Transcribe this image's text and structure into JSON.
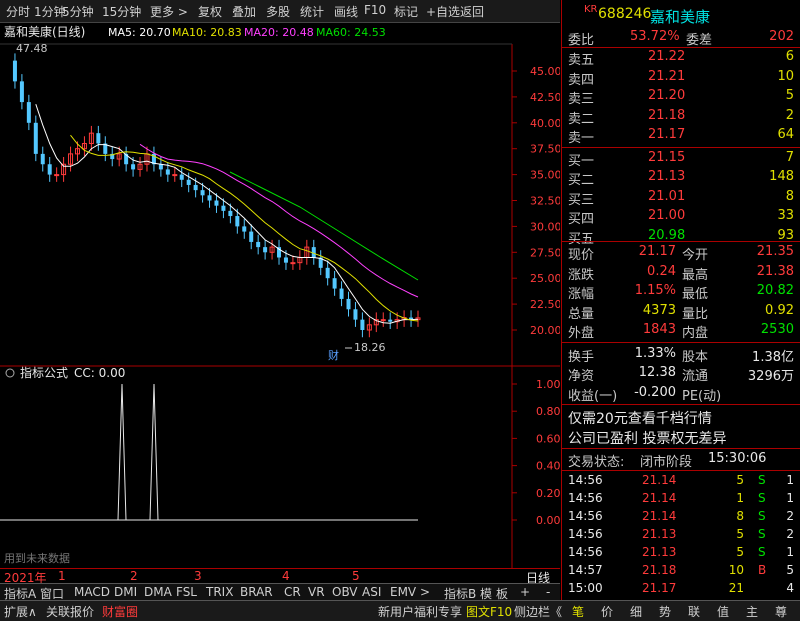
{
  "toolbar": {
    "items": [
      "分时",
      "1分钟",
      "5分钟",
      "15分钟",
      "更多 >",
      "复权",
      "叠加",
      "多股",
      "统计",
      "画线",
      "F10",
      "标记",
      "+自选",
      "返回"
    ]
  },
  "header": {
    "title": "嘉和美康(日线)",
    "ma5": "MA5: 20.70",
    "ma10": "MA10: 20.83",
    "ma20": "MA20: 20.48",
    "ma60": "MA60: 24.53"
  },
  "price_axis": [
    "45.00",
    "42.50",
    "40.00",
    "37.50",
    "35.00",
    "32.50",
    "30.00",
    "27.50",
    "25.00",
    "22.50",
    "20.00"
  ],
  "annotations": {
    "high": "47.48",
    "low": "18.26",
    "finance_marker": "财"
  },
  "indicator": {
    "title": "指标公式",
    "cc": "CC: 0.00",
    "axis": [
      "1.00",
      "0.80",
      "0.60",
      "0.40",
      "0.20",
      "0.00"
    ],
    "footer_note": "用到未来数据"
  },
  "date_axis": {
    "year": "2021年",
    "months": [
      "1",
      "2",
      "3",
      "4",
      "5"
    ],
    "period": "日线"
  },
  "indicator_tabs": [
    "指标A",
    "窗口",
    "MACD",
    "DMI",
    "DMA",
    "FSL",
    "TRIX",
    "BRAR",
    "CR",
    "VR",
    "OBV",
    "ASI",
    "EMV",
    ">",
    "指标B",
    "模",
    "板",
    "+",
    "-"
  ],
  "stock": {
    "badge": "KR",
    "code": "688246",
    "name": "嘉和美康"
  },
  "order_book": {
    "weibi_label": "委比",
    "weibi": "53.72%",
    "weicha_label": "委差",
    "weicha": "202",
    "asks": [
      {
        "label": "卖五",
        "price": "21.22",
        "vol": "6"
      },
      {
        "label": "卖四",
        "price": "21.21",
        "vol": "10"
      },
      {
        "label": "卖三",
        "price": "21.20",
        "vol": "5"
      },
      {
        "label": "卖二",
        "price": "21.18",
        "vol": "2"
      },
      {
        "label": "卖一",
        "price": "21.17",
        "vol": "64"
      }
    ],
    "bids": [
      {
        "label": "买一",
        "price": "21.15",
        "vol": "7"
      },
      {
        "label": "买二",
        "price": "21.13",
        "vol": "148"
      },
      {
        "label": "买三",
        "price": "21.01",
        "vol": "8"
      },
      {
        "label": "买四",
        "price": "21.00",
        "vol": "33"
      },
      {
        "label": "买五",
        "price": "20.98",
        "vol": "93"
      }
    ]
  },
  "quote": [
    {
      "l1": "现价",
      "v1": "21.17",
      "l2": "今开",
      "v2": "21.35"
    },
    {
      "l1": "涨跌",
      "v1": "0.24",
      "l2": "最高",
      "v2": "21.38"
    },
    {
      "l1": "涨幅",
      "v1": "1.15%",
      "l2": "最低",
      "v2": "20.82"
    },
    {
      "l1": "总量",
      "v1": "4373",
      "l2": "量比",
      "v2": "0.92"
    },
    {
      "l1": "外盘",
      "v1": "1843",
      "l2": "内盘",
      "v2": "2530"
    }
  ],
  "stats": [
    {
      "l1": "换手",
      "v1": "1.33%",
      "l2": "股本",
      "v2": "1.38亿"
    },
    {
      "l1": "净资",
      "v1": "12.38",
      "l2": "流通",
      "v2": "3296万"
    },
    {
      "l1": "收益(一)",
      "v1": "-0.200",
      "l2": "PE(动)",
      "v2": ""
    }
  ],
  "notices": [
    "仅需20元查看千档行情",
    "公司已盈利 投票权无差异"
  ],
  "trade_status": {
    "label": "交易状态:",
    "value": "闭市阶段",
    "time": "15:30:06"
  },
  "ticks": [
    {
      "time": "14:56",
      "price": "21.14",
      "vol": "5",
      "side": "S",
      "n": "1"
    },
    {
      "time": "14:56",
      "price": "21.14",
      "vol": "1",
      "side": "S",
      "n": "1"
    },
    {
      "time": "14:56",
      "price": "21.14",
      "vol": "8",
      "side": "S",
      "n": "2"
    },
    {
      "time": "14:56",
      "price": "21.13",
      "vol": "5",
      "side": "S",
      "n": "2"
    },
    {
      "time": "14:56",
      "price": "21.13",
      "vol": "5",
      "side": "S",
      "n": "1"
    },
    {
      "time": "14:57",
      "price": "21.18",
      "vol": "10",
      "side": "B",
      "n": "5"
    },
    {
      "time": "15:00",
      "price": "21.17",
      "vol": "21",
      "side": "",
      "n": "4"
    }
  ],
  "bottom": {
    "left": [
      "扩展∧",
      "关联报价",
      "财富圈"
    ],
    "middle": [
      "新用户福利专享",
      "图文F10",
      "侧边栏《"
    ],
    "right": [
      "笔",
      "价",
      "细",
      "势",
      "联",
      "值",
      "主",
      "尊"
    ]
  },
  "colors": {
    "up": "#ff3b3b",
    "down": "#00e000",
    "ma5": "#ffffff",
    "ma10": "#e0e000",
    "ma20": "#ff40ff",
    "ma60": "#00e000",
    "frame": "#aa0000"
  }
}
